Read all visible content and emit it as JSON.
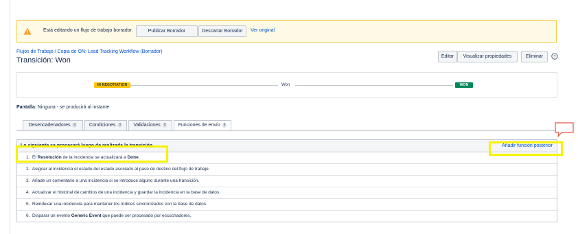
{
  "banner": {
    "message": "Está editando un flujo de trabajo borrador.",
    "publish_label": "Publicar Borrador",
    "discard_label": "Descartar Borrador",
    "view_original_label": "Ver original"
  },
  "breadcrumb": "Flujos de Trabajo  /  Copia de ON: Lead Tracking Workflow (Borrador)",
  "page_title": "Transición: Won",
  "header_buttons": {
    "edit_label": "Editar",
    "view_props_label": "Visualizar propiedades",
    "delete_label": "Eliminar"
  },
  "flow": {
    "from_status": "IN NEGOTIATION",
    "transition": "Won",
    "to_status": "WON"
  },
  "screen": {
    "label": "Pantalla",
    "value": ": Ninguna - se producirá al instante"
  },
  "tabs": [
    {
      "label": "Desencadenadores",
      "count": "0"
    },
    {
      "label": "Condiciones",
      "count": "0"
    },
    {
      "label": "Validaciones",
      "count": "0"
    },
    {
      "label": "Funciones de envío",
      "count": "6"
    }
  ],
  "post_functions": {
    "header": "Lo siguiente se procesará luego de realizada la transición",
    "add_label": "Añadir función posterior",
    "items": [
      {
        "num": "1.",
        "pre": "El ",
        "b1": "Resolución",
        "mid": " de la incidencia se actualizará a ",
        "b2": "Done",
        "post": "."
      },
      {
        "num": "2.",
        "text": "Asignar al incidencia el estado del estado asociado al paso de destino del flujo de trabajo."
      },
      {
        "num": "3.",
        "text": "Añade un comentario a una incidencia si se introduce alguno durante una transición."
      },
      {
        "num": "4.",
        "text": "Actualizar el historial de cambios de una incidencia y guardar la incidencia en la base de datos."
      },
      {
        "num": "5.",
        "text": "Reindexar una incidencia para mantener los índices sincronizados con la base de datos."
      },
      {
        "num": "6.",
        "pre": "Disparar un evento ",
        "b1": "Generic Event",
        "post": " que puede ser procesado por escuchadores."
      }
    ]
  },
  "colors": {
    "link": "#0052cc",
    "highlight": "#f7f300",
    "banner_bg": "#fffae6",
    "status_yellow": "#ffc400",
    "status_green": "#00875a",
    "callout": "#e2583e"
  }
}
